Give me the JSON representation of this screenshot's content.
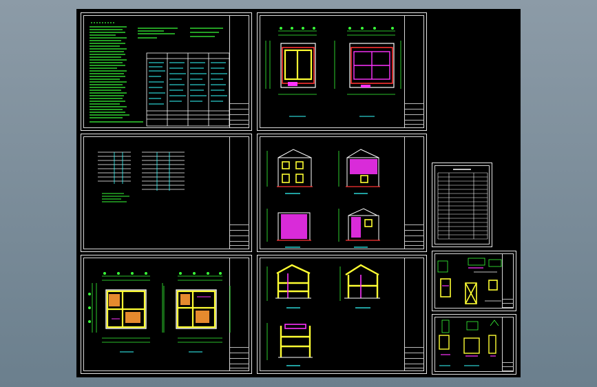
{
  "colors": {
    "canvas": "#000000",
    "frame": "#e8e8e8",
    "green": "#39ff39",
    "yellow": "#ffff33",
    "magenta": "#ff33ff",
    "cyan": "#33ffff",
    "white": "#ffffff",
    "red": "#ff3333"
  },
  "sheets": [
    {
      "id": "notes",
      "kind": "design-notes"
    },
    {
      "id": "schedule",
      "kind": "door-window-schedule"
    },
    {
      "id": "floor-plans-1",
      "kind": "floor-plans"
    },
    {
      "id": "floor-plans-2",
      "kind": "floor-plans"
    },
    {
      "id": "elevations",
      "kind": "elevations"
    },
    {
      "id": "sections",
      "kind": "sections"
    },
    {
      "id": "index",
      "kind": "drawing-index"
    },
    {
      "id": "details-1",
      "kind": "details"
    },
    {
      "id": "details-2",
      "kind": "details"
    }
  ]
}
